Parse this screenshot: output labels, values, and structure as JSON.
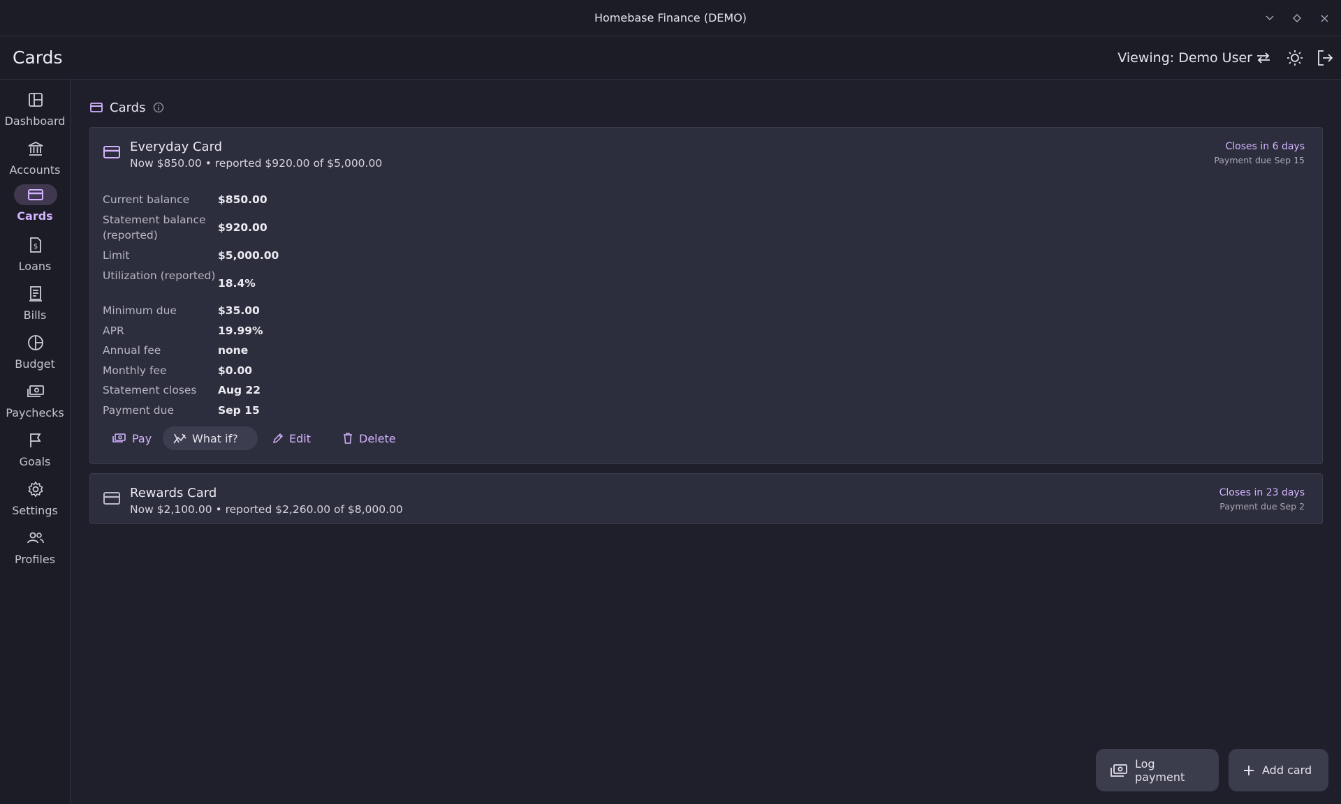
{
  "window": {
    "title": "Homebase Finance (DEMO)"
  },
  "header": {
    "title": "Cards",
    "viewing_label": "Viewing: Demo User",
    "icons": [
      "swap-icon",
      "theme-toggle-icon",
      "logout-icon"
    ]
  },
  "sidebar": {
    "items": [
      {
        "label": "Dashboard",
        "icon": "dashboard-icon"
      },
      {
        "label": "Accounts",
        "icon": "bank-icon"
      },
      {
        "label": "Cards",
        "icon": "card-icon",
        "active": true
      },
      {
        "label": "Loans",
        "icon": "loan-icon"
      },
      {
        "label": "Bills",
        "icon": "bill-icon"
      },
      {
        "label": "Budget",
        "icon": "budget-icon"
      },
      {
        "label": "Paychecks",
        "icon": "paycheck-icon"
      },
      {
        "label": "Goals",
        "icon": "flag-icon"
      },
      {
        "label": "Settings",
        "icon": "gear-icon"
      },
      {
        "label": "Profiles",
        "icon": "people-icon"
      }
    ]
  },
  "section": {
    "title": "Cards"
  },
  "cards": [
    {
      "name": "Everyday Card",
      "summary": "Now $850.00 • reported $920.00 of $5,000.00",
      "closes": "Closes in 6 days",
      "payment_due": "Payment due Sep 15",
      "details": [
        {
          "label": "Current balance",
          "value": "$850.00"
        },
        {
          "label": "Statement balance (reported)",
          "value": "$920.00"
        },
        {
          "label": "Limit",
          "value": "$5,000.00"
        },
        {
          "label": "Utilization (reported)",
          "value": "18.4%"
        },
        {
          "label": "Minimum due",
          "value": "$35.00"
        },
        {
          "label": "APR",
          "value": "19.99%"
        },
        {
          "label": "Annual fee",
          "value": "none"
        },
        {
          "label": "Monthly fee",
          "value": "$0.00"
        },
        {
          "label": "Statement closes",
          "value": "Aug 22"
        },
        {
          "label": "Payment due",
          "value": "Sep 15"
        }
      ],
      "actions": {
        "pay": "Pay",
        "what_if": "What if?",
        "edit": "Edit",
        "delete": "Delete"
      }
    },
    {
      "name": "Rewards Card",
      "summary": "Now $2,100.00 • reported $2,260.00 of $8,000.00",
      "closes": "Closes in 23 days",
      "payment_due": "Payment due Sep 2"
    }
  ],
  "fabs": {
    "log_payment": "Log payment",
    "add_card": "Add card"
  },
  "colors": {
    "accent": "#d3b3ff",
    "background": "#1f1f2c",
    "surface": "#2d2e3d"
  }
}
